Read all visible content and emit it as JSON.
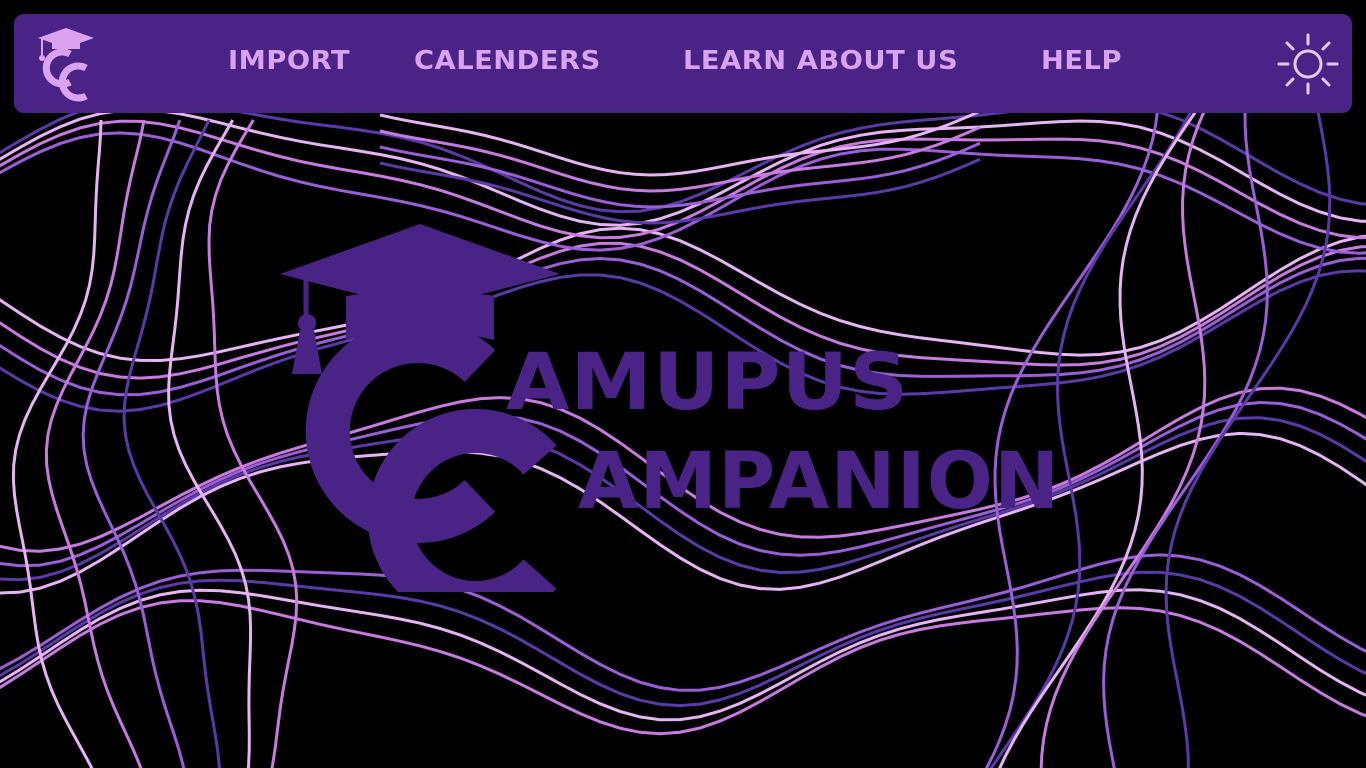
{
  "nav": {
    "logo_icon": "campus-companion-logo",
    "links": [
      {
        "label": "IMPORT"
      },
      {
        "label": "CALENDERS"
      },
      {
        "label": "LEARN ABOUT US"
      },
      {
        "label": "HELP"
      }
    ],
    "theme_toggle_icon": "sun-icon"
  },
  "hero": {
    "logo_icon": "graduation-cap-cc-logo",
    "line1": "AMUPUS",
    "line2": "AMPANION"
  },
  "colors": {
    "background": "#000000",
    "navbar": "#4a2386",
    "nav_text": "#d9a3f0",
    "hero_text": "#4a2386",
    "wave_colors": [
      "#e6b3f5",
      "#c77ae0",
      "#9a5ed8",
      "#5a3aa8"
    ]
  }
}
